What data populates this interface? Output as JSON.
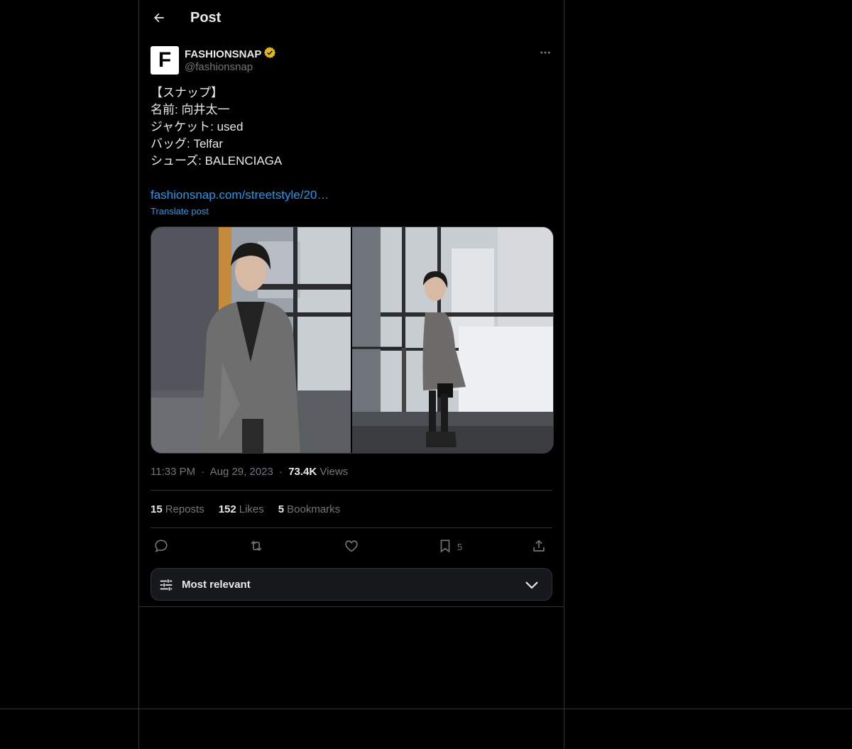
{
  "header": {
    "title": "Post"
  },
  "author": {
    "avatar_letter": "F",
    "display_name": "FASHIONSNAP",
    "handle": "@fashionsnap"
  },
  "post": {
    "lines": [
      "【スナップ】",
      "名前: 向井太一",
      "ジャケット: used",
      "バッグ: Telfar",
      "シューズ: BALENCIAGA"
    ],
    "link_text": "fashionsnap.com/streetstyle/20…",
    "translate_label": "Translate post"
  },
  "meta": {
    "time": "11:33 PM",
    "date": "Aug 29, 2023",
    "views_count": "73.4K",
    "views_label": "Views",
    "separator": "·"
  },
  "stats": {
    "reposts_count": "15",
    "reposts_label": "Reposts",
    "likes_count": "152",
    "likes_label": "Likes",
    "bookmarks_count": "5",
    "bookmarks_label": "Bookmarks"
  },
  "actions": {
    "bookmark_count": "5"
  },
  "sort": {
    "label": "Most relevant"
  },
  "colors": {
    "background": "#000000",
    "border": "#2f3336",
    "text": "#e7e9ea",
    "muted": "#71767b",
    "link": "#1d9bf0",
    "verified_badge": "#e2b719"
  }
}
